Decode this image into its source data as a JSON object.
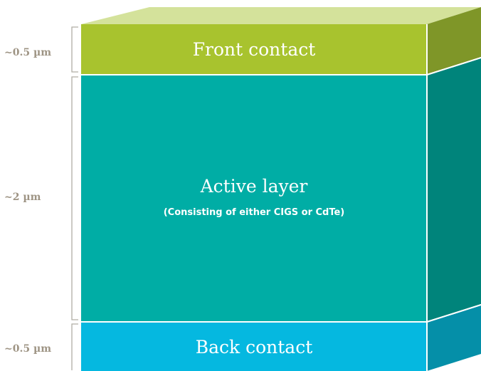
{
  "layers": {
    "front": {
      "title": "Front contact",
      "thickness": "~0.5 µm",
      "colors": {
        "front": "#a8c32e",
        "side": "#7f9628",
        "top": "#d4e29b"
      }
    },
    "active": {
      "title": "Active layer",
      "subtitle": "(Consisting of either CIGS or CdTe)",
      "thickness": "~2 µm",
      "colors": {
        "front": "#00ada5",
        "side": "#00847b"
      }
    },
    "back": {
      "title": "Back contact",
      "thickness": "~0.5 µm",
      "colors": {
        "front": "#05b8e0",
        "side": "#058fa8"
      }
    }
  },
  "colors": {
    "bracket": "#b0ada5",
    "label": "#9e9484"
  }
}
